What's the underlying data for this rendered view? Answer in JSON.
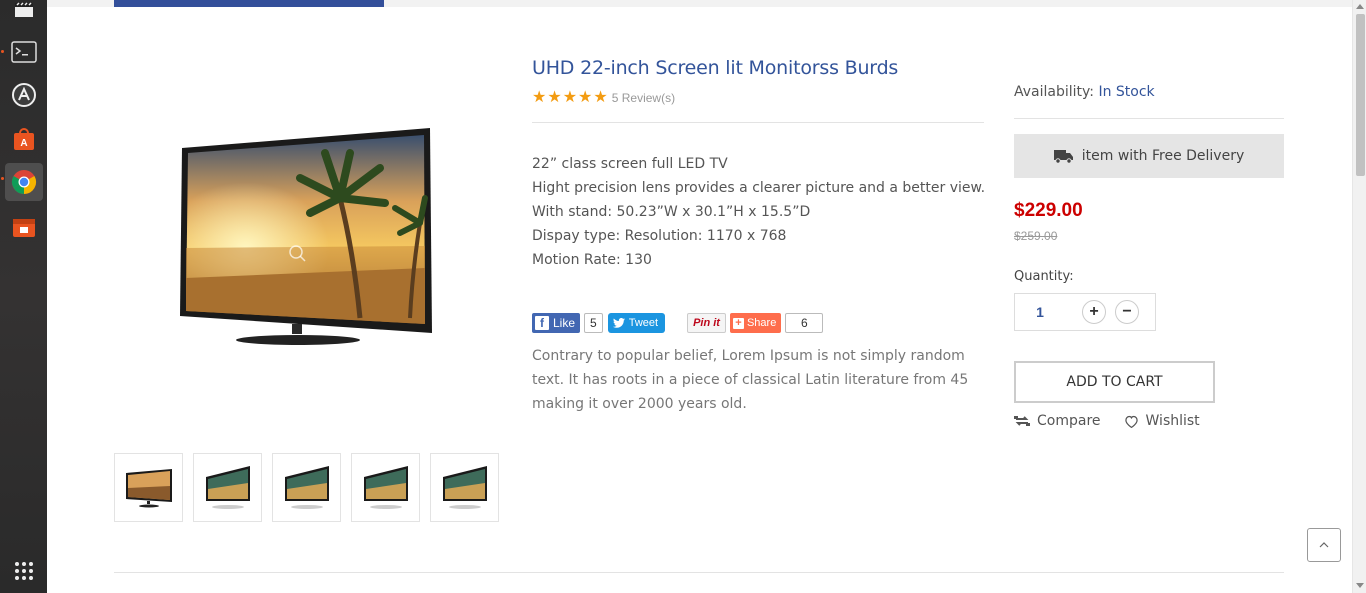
{
  "dock": {
    "items": [
      {
        "name": "clapper-icon"
      },
      {
        "name": "terminal-icon"
      },
      {
        "name": "software-updater-icon"
      },
      {
        "name": "software-center-icon"
      },
      {
        "name": "chrome-icon"
      },
      {
        "name": "screenshot-icon"
      },
      {
        "name": "app-grid-icon"
      }
    ]
  },
  "product": {
    "title": "UHD 22-inch Screen lit Monitorss Burds",
    "stars": 5,
    "reviews": "5 Review(s)",
    "description_lines": [
      "22” class screen full LED TV",
      "Hight precision lens provides a clearer picture and a better view.",
      "With stand: 50.23”W x 30.1”H x 15.5”D",
      "Dispay type: Resolution: 1170 x 768",
      "Motion Rate: 130"
    ],
    "paragraph": "Contrary to popular belief, Lorem Ipsum is not simply random text. It has roots in a piece of classical Latin literature from 45 making it over 2000 years old.",
    "thumbnail_count": 5
  },
  "social": {
    "like_label": "Like",
    "like_count": "5",
    "tweet_label": "Tweet",
    "pin_label": "Pin it",
    "share_label": "Share",
    "share_count": "6"
  },
  "sidebar": {
    "availability_label": "Availability:",
    "availability_value": "In Stock",
    "delivery_text": "item with Free Delivery",
    "price": "$229.00",
    "old_price": "$259.00",
    "quantity_label": "Quantity:",
    "quantity_value": "1",
    "plus": "+",
    "minus": "−",
    "add_to_cart": "ADD TO CART",
    "compare_label": "Compare",
    "wishlist_label": "Wishlist"
  },
  "colors": {
    "accent": "#33549a",
    "price": "#cc0000",
    "star": "#f39c12"
  }
}
